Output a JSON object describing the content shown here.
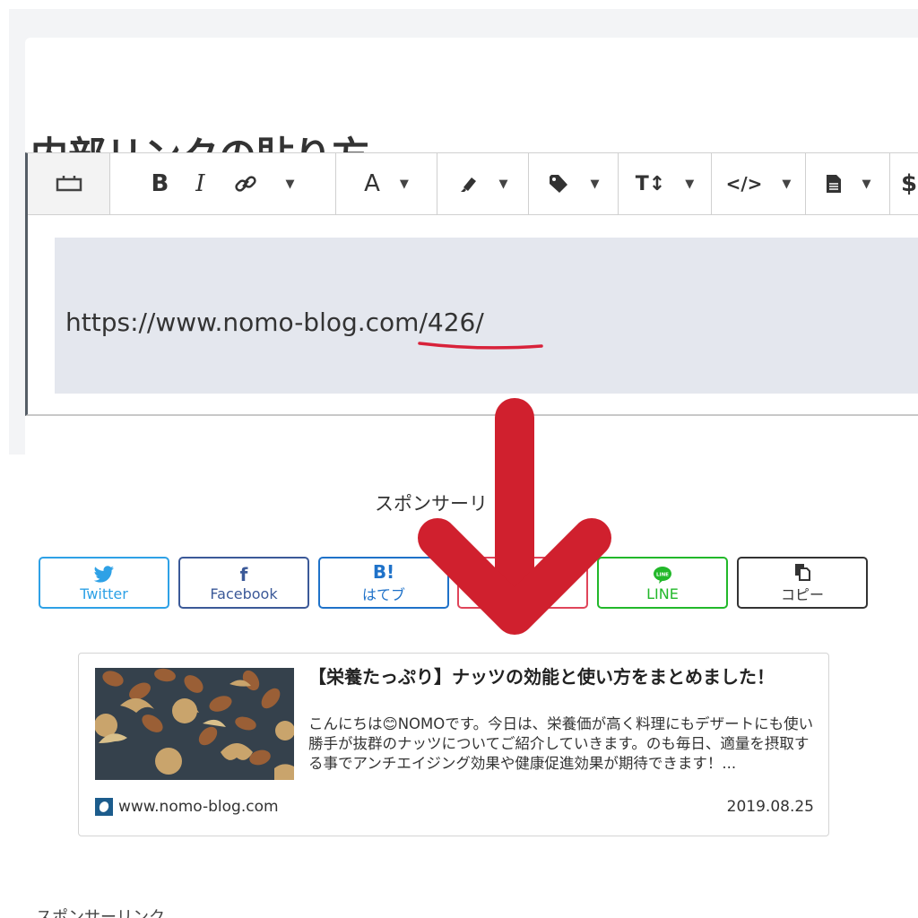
{
  "page": {
    "heading": "内部リンクの貼り方",
    "bottom_heading": "スポンサーリンク"
  },
  "editor": {
    "toolbar": [
      {
        "name": "block-icon",
        "glyph": "▭",
        "caret": false
      },
      {
        "name": "bold-icon",
        "glyph": "B",
        "caret": false
      },
      {
        "name": "italic-icon",
        "glyph": "I",
        "caret": false
      },
      {
        "name": "link-icon",
        "glyph": "🔗",
        "caret": true
      },
      {
        "name": "text-color-icon",
        "glyph": "A",
        "caret": true
      },
      {
        "name": "highlighter-icon",
        "glyph": "✎",
        "caret": true
      },
      {
        "name": "tag-icon",
        "glyph": "🏷",
        "caret": true
      },
      {
        "name": "font-size-icon",
        "glyph": "T↕",
        "caret": true
      },
      {
        "name": "code-icon",
        "glyph": "</>",
        "caret": true
      },
      {
        "name": "document-icon",
        "glyph": "🗎",
        "caret": true
      },
      {
        "name": "dollar-icon",
        "glyph": "$",
        "caret": false
      }
    ],
    "url_text": "https://www.nomo-blog.com/426/"
  },
  "sponsor_label": "スポンサーリ",
  "share_buttons": [
    {
      "name": "twitter",
      "label": "Twitter",
      "icon": "twitter-bird-icon",
      "color": "#2ea1e6"
    },
    {
      "name": "facebook",
      "label": "Facebook",
      "icon": "facebook-f-icon",
      "color": "#3b5998"
    },
    {
      "name": "hatena",
      "label": "はてブ",
      "icon": "hatena-b-icon",
      "color": "#1f72c9"
    },
    {
      "name": "pocket",
      "label": "",
      "icon": "pocket-icon",
      "color": "#e0455a"
    },
    {
      "name": "line",
      "label": "LINE",
      "icon": "line-icon",
      "color": "#22b82a"
    },
    {
      "name": "copy",
      "label": "コピー",
      "icon": "copy-icon",
      "color": "#333333"
    }
  ],
  "blog_card": {
    "title": "【栄養たっぷり】ナッツの効能と使い方をまとめました！",
    "description": "こんにちは😊NOMOです。今日は、栄養価が高く料理にもデザートにも使い勝手が抜群のナッツについてご紹介していきます。のも毎日、適量を摂取する事でアンチエイジング効果や健康促進効果が期待できます！...",
    "site": "www.nomo-blog.com",
    "date": "2019.08.25"
  },
  "colors": {
    "arrow": "#d0202e",
    "underline": "#d8223a",
    "code_bg": "#e4e7ee"
  }
}
